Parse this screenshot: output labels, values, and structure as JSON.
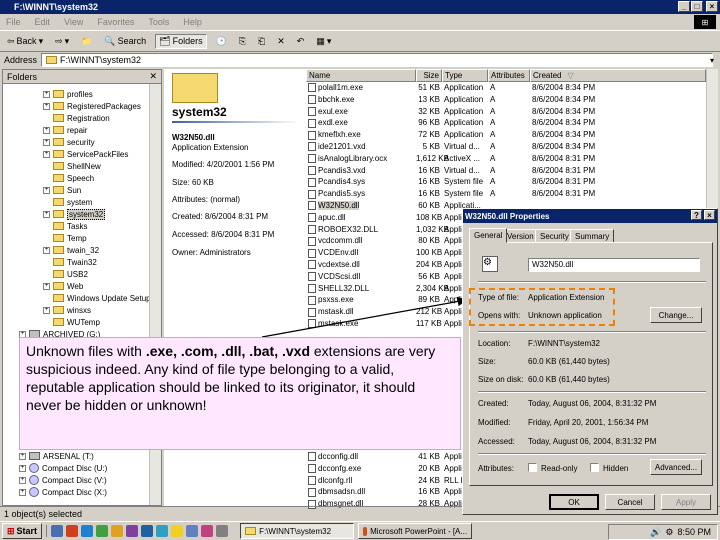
{
  "window": {
    "title": "F:\\WINNT\\system32"
  },
  "menu": [
    "File",
    "Edit",
    "View",
    "Favorites",
    "Tools",
    "Help"
  ],
  "toolbar": {
    "back": "Back",
    "search": "Search",
    "folders": "Folders"
  },
  "address": {
    "label": "Address",
    "value": "F:\\WINNT\\system32"
  },
  "folders": {
    "header": "Folders",
    "items": [
      {
        "label": "profiles",
        "type": "folder",
        "expand": "+"
      },
      {
        "label": "RegisteredPackages",
        "type": "folder",
        "expand": "+"
      },
      {
        "label": "Registration",
        "type": "folder",
        "expand": ""
      },
      {
        "label": "repair",
        "type": "folder",
        "expand": "+"
      },
      {
        "label": "security",
        "type": "folder",
        "expand": "+"
      },
      {
        "label": "ServicePackFiles",
        "type": "folder",
        "expand": "+"
      },
      {
        "label": "ShellNew",
        "type": "folder",
        "expand": ""
      },
      {
        "label": "Speech",
        "type": "folder",
        "expand": ""
      },
      {
        "label": "Sun",
        "type": "folder",
        "expand": "+"
      },
      {
        "label": "system",
        "type": "folder",
        "expand": ""
      },
      {
        "label": "system32",
        "type": "folder",
        "expand": "+"
      },
      {
        "label": "Tasks",
        "type": "folder",
        "expand": ""
      },
      {
        "label": "Temp",
        "type": "folder",
        "expand": ""
      },
      {
        "label": "twain_32",
        "type": "folder",
        "expand": "+"
      },
      {
        "label": "Twain32",
        "type": "folder",
        "expand": ""
      },
      {
        "label": "USB2",
        "type": "folder",
        "expand": ""
      },
      {
        "label": "Web",
        "type": "folder",
        "expand": "+"
      },
      {
        "label": "Windows Update Setup",
        "type": "folder",
        "expand": ""
      },
      {
        "label": "winsxs",
        "type": "folder",
        "expand": "+"
      },
      {
        "label": "WUTemp",
        "type": "folder",
        "expand": ""
      },
      {
        "label": "ARCHIVED (G:)",
        "type": "drive",
        "expand": "+"
      }
    ],
    "bottom_items": [
      {
        "label": "ARSENAL (T:)",
        "type": "drive",
        "expand": "+"
      },
      {
        "label": "Compact Disc (U:)",
        "type": "cd",
        "expand": "+"
      },
      {
        "label": "Compact Disc (V:)",
        "type": "cd",
        "expand": "+"
      },
      {
        "label": "Compact Disc (X:)",
        "type": "cd",
        "expand": "+"
      }
    ]
  },
  "webview": {
    "folder": "system32",
    "file": "W32N50.dll",
    "filetype": "Application Extension",
    "modified": "Modified: 4/20/2001 1:56 PM",
    "size": "Size: 60 KB",
    "attributes": "Attributes: (normal)",
    "created": "Created: 8/6/2004 8:31 PM",
    "accessed": "Accessed: 8/6/2004 8:31 PM",
    "owner": "Owner: Administrators"
  },
  "filelist": {
    "columns": [
      "Name",
      "Size",
      "Type",
      "Attributes",
      "Created"
    ],
    "rows": [
      [
        "polall1m.exe",
        "51 KB",
        "Application",
        "A",
        "8/6/2004 8:34 PM"
      ],
      [
        "bbchk.exe",
        "13 KB",
        "Application",
        "A",
        "8/6/2004 8:34 PM"
      ],
      [
        "exul.exe",
        "32 KB",
        "Application",
        "A",
        "8/6/2004 8:34 PM"
      ],
      [
        "exdl.exe",
        "96 KB",
        "Application",
        "A",
        "8/6/2004 8:34 PM"
      ],
      [
        "kmeflxh.exe",
        "72 KB",
        "Application",
        "A",
        "8/6/2004 8:34 PM"
      ],
      [
        "ide21201.vxd",
        "5 KB",
        "Virtual d...",
        "A",
        "8/6/2004 8:34 PM"
      ],
      [
        "isAnalogLibrary.ocx",
        "1,612 KB",
        "ActiveX ...",
        "A",
        "8/6/2004 8:31 PM"
      ],
      [
        "Pcandis3.vxd",
        "16 KB",
        "Virtual d...",
        "A",
        "8/6/2004 8:31 PM"
      ],
      [
        "Pcandis4.sys",
        "16 KB",
        "System file",
        "A",
        "8/6/2004 8:31 PM"
      ],
      [
        "Pcandis5.sys",
        "16 KB",
        "System file",
        "A",
        "8/6/2004 8:31 PM"
      ],
      [
        "W32N50.dll",
        "60 KB",
        "Applicati...",
        "",
        ""
      ],
      [
        "apuc.dll",
        "108 KB",
        "Applicati...",
        "",
        ""
      ],
      [
        "ROBOEX32.DLL",
        "1,032 KB",
        "Applicati...",
        "",
        ""
      ],
      [
        "vcdcomm.dll",
        "80 KB",
        "Applicati...",
        "",
        ""
      ],
      [
        "VCDEnv.dll",
        "100 KB",
        "Applicati...",
        "",
        ""
      ],
      [
        "vcdextse.dll",
        "204 KB",
        "Applicati...",
        "",
        ""
      ],
      [
        "VCDScsi.dll",
        "56 KB",
        "Applicati...",
        "",
        ""
      ],
      [
        "SHELL32.DLL",
        "2,304 KB",
        "Applicati...",
        "",
        ""
      ],
      [
        "psxss.exe",
        "89 KB",
        "Applicati...",
        "",
        ""
      ],
      [
        "mstask.dll",
        "212 KB",
        "Applicati...",
        "",
        ""
      ],
      [
        "mstask.exe",
        "117 KB",
        "Applicati...",
        "",
        ""
      ]
    ],
    "bottom_rows": [
      [
        "dcconfig.dll",
        "41 KB",
        "Appli..."
      ],
      [
        "dcconfg.exe",
        "20 KB",
        "Applic..."
      ],
      [
        "dlconfg.rll",
        "24 KB",
        "RLL F..."
      ],
      [
        "dbmsadsn.dll",
        "16 KB",
        "Appli..."
      ],
      [
        "dbmsgnet.dll",
        "28 KB",
        "Appli..."
      ]
    ]
  },
  "status": {
    "text": "1 object(s) selected"
  },
  "callout": {
    "p1": "Unknown files with ",
    "ext": ".exe, .com, .dll, .bat, .vxd",
    "p2": " extensions are very suspicious indeed. Any kind of file type belonging to a valid, reputable application should be linked to its originator, it should never be hidden or unknown!"
  },
  "properties": {
    "title": "W32N50.dll Properties",
    "tabs": [
      "General",
      "Version",
      "Security",
      "Summary"
    ],
    "name": "W32N50.dll",
    "type_label": "Type of file:",
    "type_value": "Application Extension",
    "opens_label": "Opens with:",
    "opens_value": "Unknown application",
    "change": "Change...",
    "location_label": "Location:",
    "location_value": "F:\\WINNT\\system32",
    "size_label": "Size:",
    "size_value": "60.0 KB (61,440 bytes)",
    "disk_label": "Size on disk:",
    "disk_value": "60.0 KB (61,440 bytes)",
    "created_label": "Created:",
    "created_value": "Today, August 06, 2004, 8:31:32 PM",
    "modified_label": "Modified:",
    "modified_value": "Friday, April 20, 2001, 1:56:34 PM",
    "accessed_label": "Accessed:",
    "accessed_value": "Today, August 06, 2004, 8:31:32 PM",
    "attributes_label": "Attributes:",
    "readonly": "Read-only",
    "hidden": "Hidden",
    "advanced": "Advanced...",
    "ok": "OK",
    "cancel": "Cancel",
    "apply": "Apply"
  },
  "taskbar": {
    "start": "Start",
    "tasks": [
      "F:\\WINNT\\system32",
      "Microsoft PowerPoint - [A..."
    ],
    "clock": "8:50 PM"
  },
  "colors": {
    "titlebar": "#0a246a",
    "callout_bg": "#ffe8ff",
    "highlight_border": "#f08000"
  }
}
